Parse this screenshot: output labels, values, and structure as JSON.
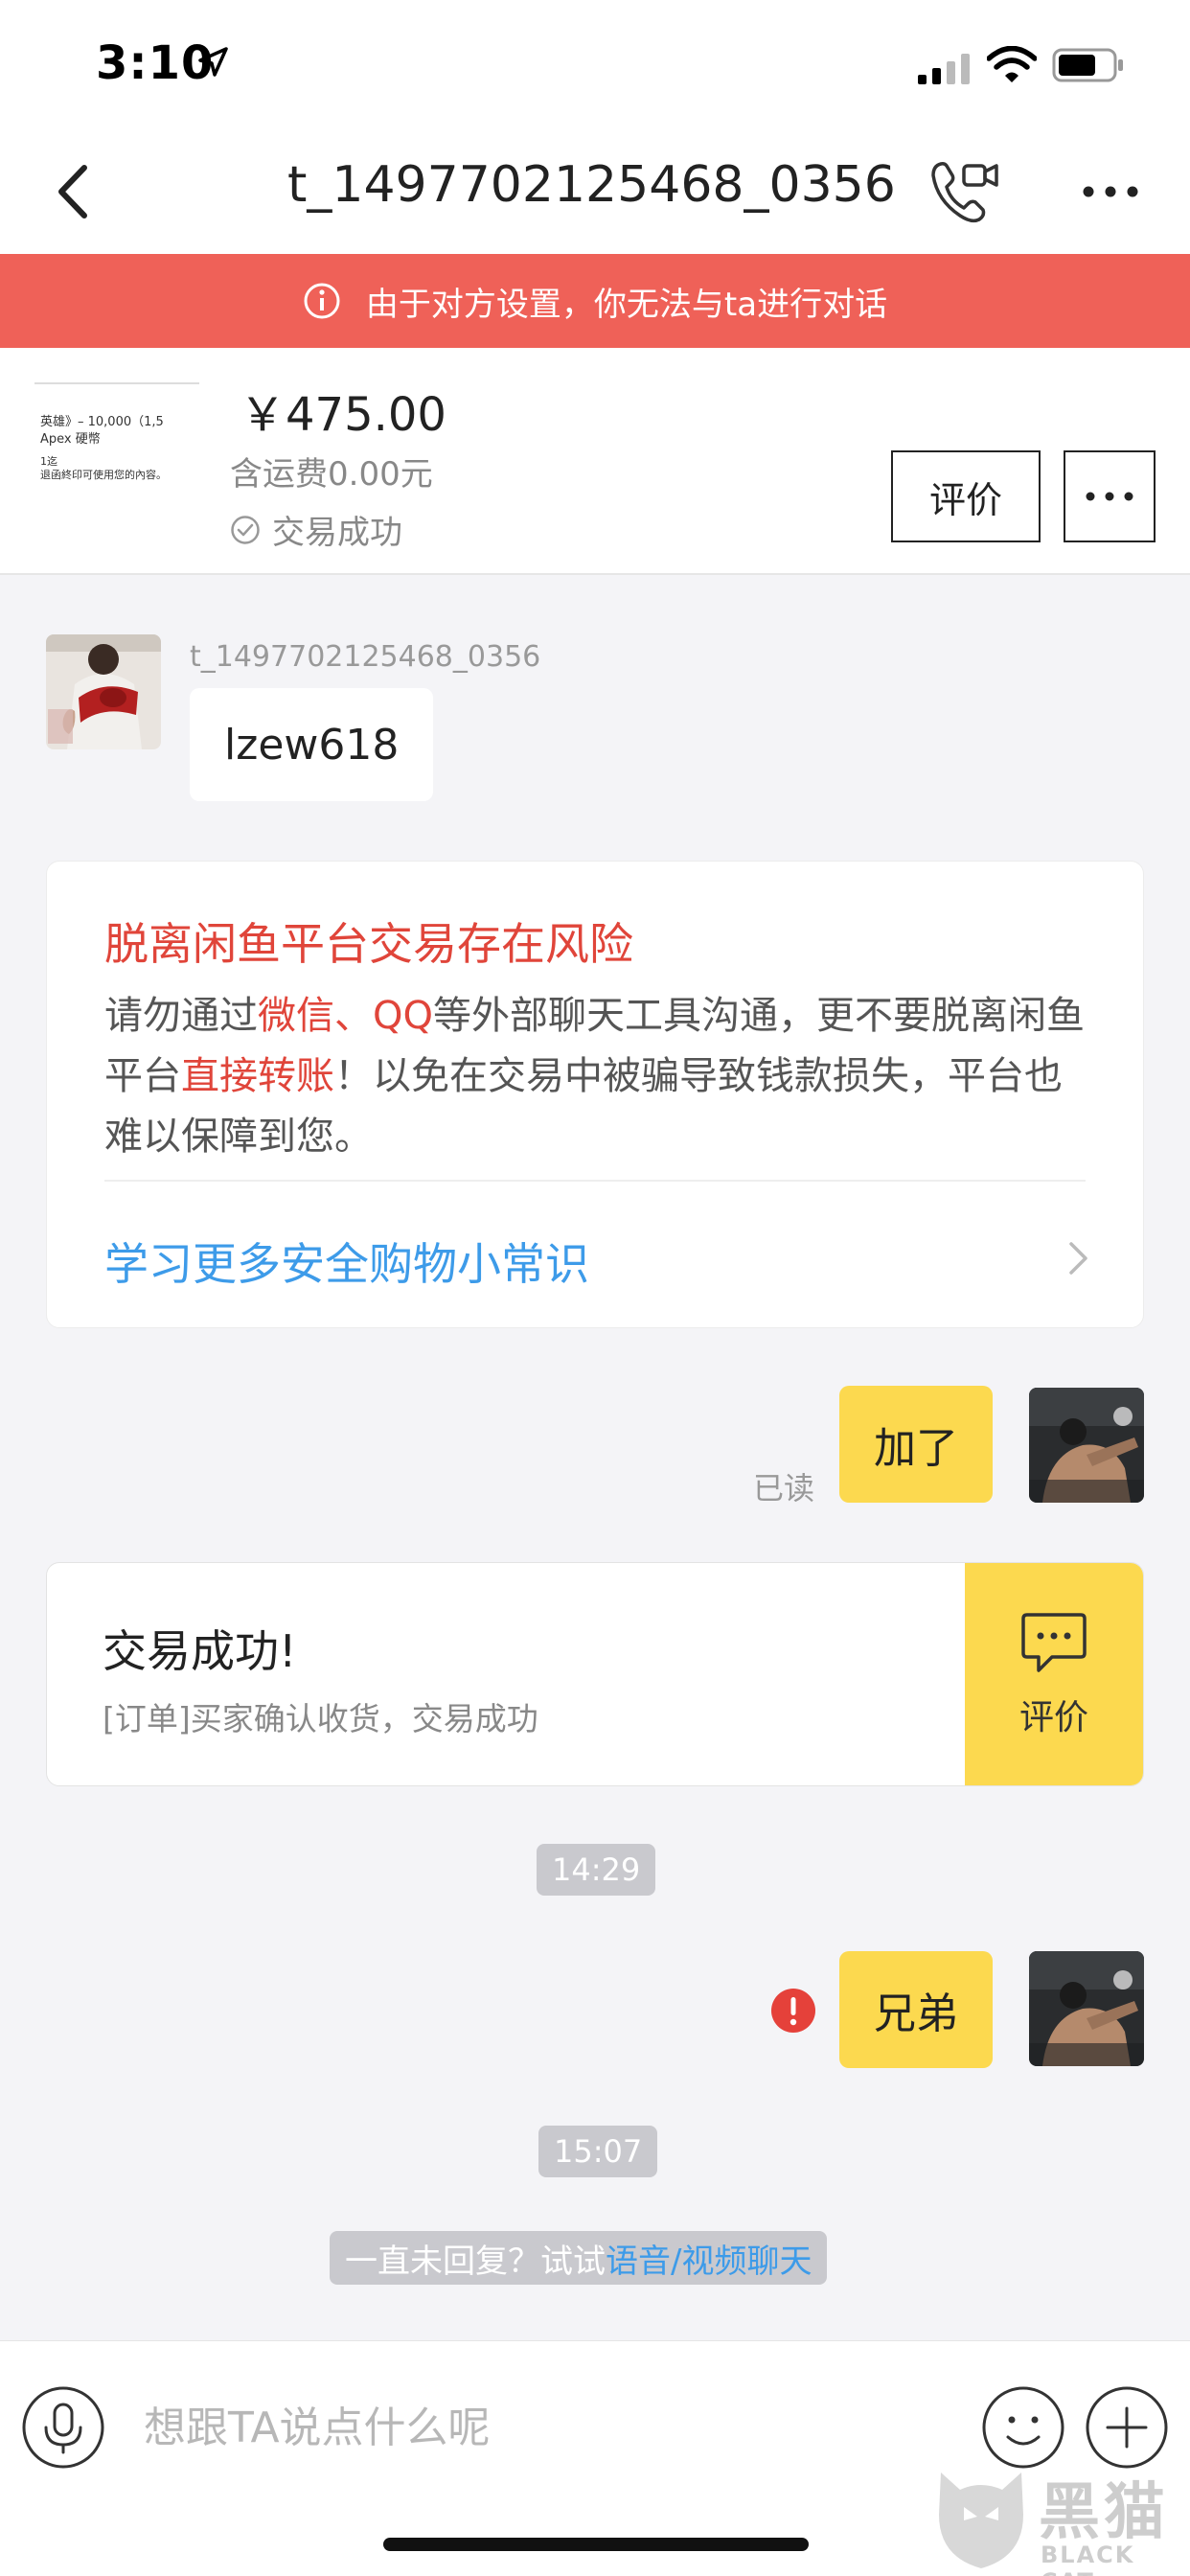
{
  "status_bar": {
    "time": "3:10"
  },
  "nav": {
    "title": "t_1497702125468_0356"
  },
  "alert": {
    "text": "由于对方设置，你无法与ta进行对话"
  },
  "product": {
    "thumb_line1": "英雄》– 10,000（1,5",
    "thumb_line2": "Apex 硬幣",
    "thumb_line3": "1迄",
    "thumb_line4": "退函終印可使用您的內容。",
    "price": "￥475.00",
    "shipping": "含运费0.00元",
    "status": "交易成功",
    "review_label": "评价"
  },
  "messages": {
    "sender_name": "t_1497702125468_0356",
    "incoming_text": "lzew618",
    "outgoing_1": "加了",
    "read_label": "已读",
    "time_1": "14:29",
    "outgoing_2": "兄弟",
    "time_2": "15:07",
    "hint_prefix": "一直未回复？试试",
    "hint_link": "语音/视频聊天"
  },
  "risk": {
    "title": "脱离闲鱼平台交易存在风险",
    "body_1": "请勿通过",
    "body_hl_1": "微信、QQ",
    "body_2": "等外部聊天工具沟通，更不要脱离闲鱼平台",
    "body_hl_2": "直接转账",
    "body_3": "！以免在交易中被骗导致钱款损失，平台也难以保障到您。",
    "link": "学习更多安全购物小常识"
  },
  "order": {
    "title": "交易成功!",
    "desc": "[订单]买家确认收货，交易成功",
    "action_label": "评价"
  },
  "input": {
    "placeholder": "想跟TA说点什么呢"
  },
  "watermark": {
    "cn": "黑猫",
    "en": "BLACK CAT"
  },
  "colors": {
    "alert_bg": "#ef6158",
    "bubble_out": "#fcd94f",
    "risk_red": "#e0453a",
    "link_blue": "#3d9be9"
  }
}
